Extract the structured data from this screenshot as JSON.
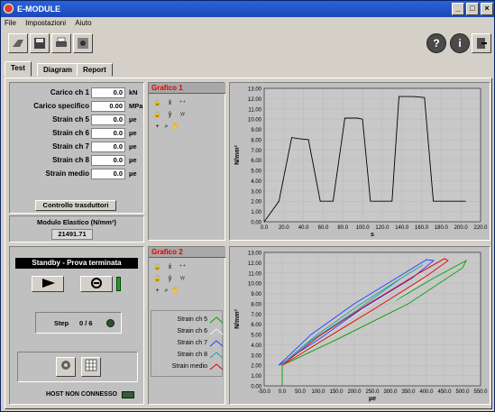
{
  "window": {
    "title": "E-MODULE"
  },
  "menu": [
    "File",
    "Impostazioni",
    "Aiuto"
  ],
  "toolbar": {
    "help_label": "?",
    "info_label": "i"
  },
  "tabs": [
    "Test",
    "Diagram",
    "Report"
  ],
  "inputs": [
    {
      "label": "Carico ch 1",
      "value": "0.0",
      "unit": "kN"
    },
    {
      "label": "Carico specifico",
      "value": "0.00",
      "unit": "MPa"
    },
    {
      "label": "Strain ch 5",
      "value": "0.0",
      "unit": "µe"
    },
    {
      "label": "Strain ch 6",
      "value": "0.0",
      "unit": "µe"
    },
    {
      "label": "Strain ch 7",
      "value": "0.0",
      "unit": "µe"
    },
    {
      "label": "Strain ch 8",
      "value": "0.0",
      "unit": "µe"
    },
    {
      "label": "Strain medio",
      "value": "0.0",
      "unit": "µe"
    }
  ],
  "controllo_button": "Controllo trasduttori",
  "modulo": {
    "label": "Modulo Elastico (N/mm²)",
    "value": "21491.71"
  },
  "status": {
    "text": "Standby - Prova terminata",
    "step_label": "Step",
    "step_value": "0 / 6",
    "host": "HOST NON CONNESSO"
  },
  "grafico1": {
    "title": "Grafico 1"
  },
  "grafico2": {
    "title": "Grafico 2",
    "legend": [
      {
        "name": "Strain ch 5",
        "color": "#00a000"
      },
      {
        "name": "Strain ch 6",
        "color": "#e0e0e0"
      },
      {
        "name": "Strain ch 7",
        "color": "#2040ff"
      },
      {
        "name": "Strain ch 8",
        "color": "#20a0a0"
      },
      {
        "name": "Strain medio",
        "color": "#e00000"
      }
    ]
  },
  "chart_data": [
    {
      "type": "line",
      "xlabel": "s",
      "ylabel": "N/mm²",
      "xlim": [
        0,
        220
      ],
      "ylim": [
        0,
        13
      ],
      "xticks": [
        "0.0",
        "20.0",
        "40.0",
        "60.0",
        "80.0",
        "100.0",
        "120.0",
        "140.0",
        "160.0",
        "180.0",
        "200.0",
        "220.0"
      ],
      "yticks": [
        "0.00",
        "1.00",
        "2.00",
        "3.00",
        "4.00",
        "5.00",
        "6.00",
        "7.00",
        "8.00",
        "9.00",
        "10.00",
        "11.00",
        "12.00",
        "13.00"
      ],
      "series": [
        {
          "color": "#000000",
          "x": [
            0,
            15,
            28,
            35,
            45,
            57,
            63,
            70,
            82,
            95,
            100,
            108,
            122,
            130,
            137,
            152,
            163,
            172,
            186,
            196,
            205
          ],
          "y": [
            0,
            2,
            8.2,
            8.1,
            8.0,
            2,
            2,
            2,
            10.1,
            10.1,
            10.0,
            2,
            2,
            2,
            12.2,
            12.2,
            12.1,
            2,
            2,
            2,
            2
          ]
        }
      ]
    },
    {
      "type": "line",
      "xlabel": "µe",
      "ylabel": "N/mm²",
      "xlim": [
        -50,
        550
      ],
      "ylim": [
        0,
        13
      ],
      "xticks": [
        "-50.0",
        "0.0",
        "50.0",
        "100.0",
        "150.0",
        "200.0",
        "250.0",
        "300.0",
        "350.0",
        "400.0",
        "450.0",
        "500.0",
        "550.0"
      ],
      "yticks": [
        "0.00",
        "1.00",
        "2.00",
        "3.00",
        "4.00",
        "5.00",
        "6.00",
        "7.00",
        "8.00",
        "9.00",
        "10.00",
        "11.00",
        "12.00",
        "13.00"
      ],
      "series": [
        {
          "name": "Strain ch 5",
          "color": "#00a000",
          "x": [
            0,
            0,
            100,
            250,
            420,
            510,
            500,
            350,
            150,
            0
          ],
          "y": [
            0,
            2,
            4,
            7,
            10.5,
            12.2,
            11.5,
            8,
            4.5,
            2
          ]
        },
        {
          "name": "Strain ch 6",
          "color": "#e0e0e0",
          "x": [
            0,
            100,
            250,
            380,
            400,
            300,
            150,
            0
          ],
          "y": [
            2,
            4.5,
            8,
            11,
            10.5,
            8,
            5,
            2
          ]
        },
        {
          "name": "Strain ch 7",
          "color": "#2040ff",
          "x": [
            -10,
            80,
            200,
            340,
            400,
            420,
            360,
            220,
            100,
            -10
          ],
          "y": [
            2,
            5,
            8,
            11,
            12.3,
            12.2,
            10.5,
            7.5,
            4.5,
            2
          ]
        },
        {
          "name": "Strain ch 8",
          "color": "#20a0a0",
          "x": [
            -5,
            90,
            210,
            330,
            390,
            330,
            200,
            80,
            -5
          ],
          "y": [
            2,
            4.8,
            7.8,
            10.5,
            11.8,
            10.5,
            7.2,
            4.4,
            2
          ]
        },
        {
          "name": "Strain medio",
          "color": "#e00000",
          "x": [
            0,
            100,
            240,
            380,
            450,
            460,
            400,
            260,
            120,
            0
          ],
          "y": [
            2,
            4.8,
            8,
            11,
            12.4,
            12.2,
            10.7,
            7.6,
            4.6,
            2
          ]
        }
      ]
    }
  ]
}
